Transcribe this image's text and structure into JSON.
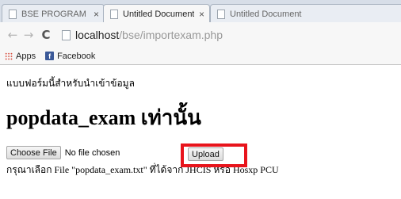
{
  "tabs": [
    {
      "title": "BSE PROGRAM",
      "close": "×"
    },
    {
      "title": "Untitled Document",
      "close": "×"
    },
    {
      "title": "Untitled Document"
    }
  ],
  "toolbar": {
    "back": "←",
    "forward": "→",
    "reload": "C",
    "url_host": "localhost",
    "url_path": "/bse/importexam.php"
  },
  "bookmarks": {
    "apps_label": "Apps",
    "facebook_icon": "f",
    "facebook_label": "Facebook"
  },
  "page": {
    "intro": "แบบฟอร์มนี้สำหรับนำเข้าข้อมูล",
    "heading": "popdata_exam เท่านั้น",
    "choose_file": "Choose File",
    "file_status": "No file chosen",
    "upload": "Upload",
    "note": "กรุณาเลือก File \"popdata_exam.txt\" ที่ได้จาก JHCIS หรือ Hosxp PCU"
  },
  "colors": {
    "highlight": "#e8141c",
    "facebook": "#3b5998"
  }
}
